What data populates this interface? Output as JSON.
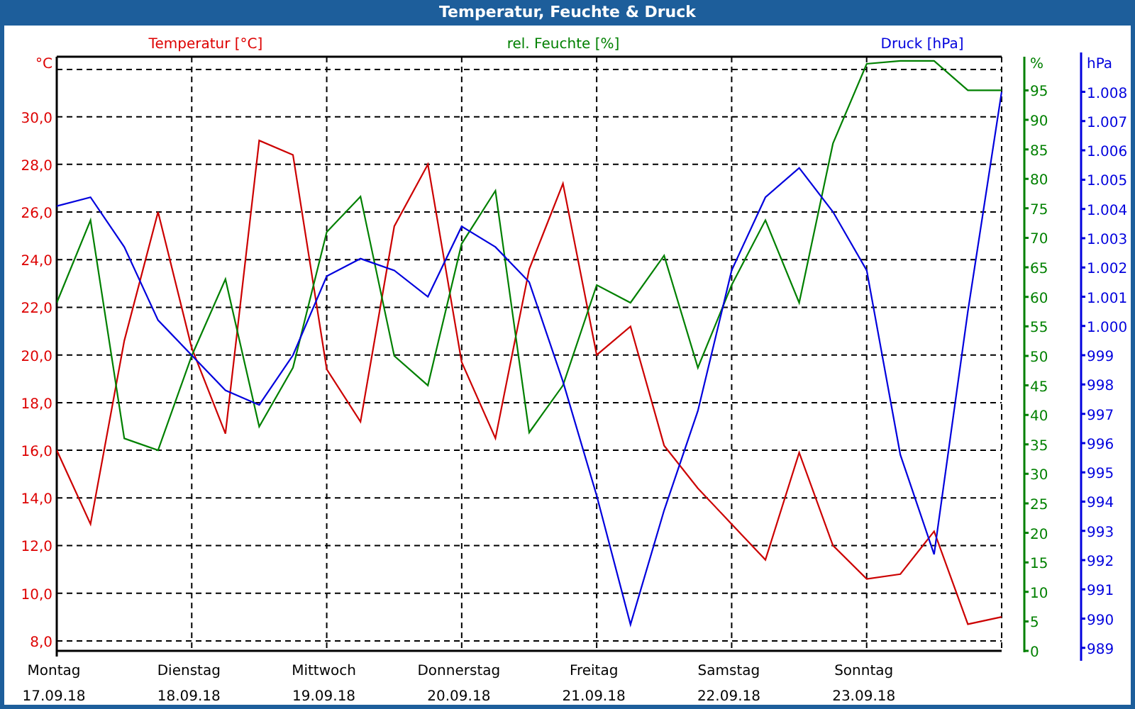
{
  "window": {
    "title": "Temperatur, Feuchte & Druck"
  },
  "chart": {
    "chart_data": {
      "type": "line",
      "grid": true,
      "categories": [
        "Montag 17.09.18",
        null,
        null,
        null,
        "Dienstag 18.09.18",
        null,
        null,
        null,
        "Mittwoch 19.09.18",
        null,
        null,
        null,
        "Donnerstag 20.09.18",
        null,
        null,
        null,
        "Freitag 21.09.18",
        null,
        null,
        null,
        "Samstag 22.09.18",
        null,
        null,
        null,
        "Sonntag 23.09.18",
        null,
        null,
        null,
        null
      ],
      "ylabel": "°C",
      "ylim": [
        7.58,
        32.52
      ],
      "yticks": [
        {
          "value": 8,
          "label": "8,0"
        },
        {
          "value": 10,
          "label": "10,0"
        },
        {
          "value": 12,
          "label": "12,0"
        },
        {
          "value": 14,
          "label": "14,0"
        },
        {
          "value": 16,
          "label": "16,0"
        },
        {
          "value": 18,
          "label": "18,0"
        },
        {
          "value": 20,
          "label": "20,0"
        },
        {
          "value": 22,
          "label": "22,0"
        },
        {
          "value": 24,
          "label": "24,0"
        },
        {
          "value": 26,
          "label": "26,0"
        },
        {
          "value": 28,
          "label": "28,0"
        },
        {
          "value": 30,
          "label": "30,0"
        }
      ],
      "y2label": "%",
      "y2lim": [
        0,
        100.7
      ],
      "y2ticks": [
        0,
        5,
        10,
        15,
        20,
        25,
        30,
        35,
        40,
        45,
        50,
        55,
        60,
        65,
        70,
        75,
        80,
        85,
        90,
        95
      ],
      "y3label": "hPa",
      "y3lim": [
        988.9,
        1009.2
      ],
      "y3ticks": [
        989,
        990,
        991,
        992,
        993,
        994,
        995,
        996,
        997,
        998,
        999,
        {
          "value": 1000,
          "label": "1.000"
        },
        {
          "value": 1001,
          "label": "1.001"
        },
        {
          "value": 1002,
          "label": "1.002"
        },
        {
          "value": 1003,
          "label": "1.003"
        },
        {
          "value": 1004,
          "label": "1.004"
        },
        {
          "value": 1005,
          "label": "1.005"
        },
        {
          "value": 1006,
          "label": "1.006"
        },
        {
          "value": 1007,
          "label": "1.007"
        },
        {
          "value": 1008,
          "label": "1.008"
        }
      ],
      "series": [
        {
          "name": "Temperatur [°C]",
          "color": "#cc0000",
          "values": [
            16.0,
            12.9,
            20.6,
            26.0,
            20.3,
            16.7,
            29.0,
            28.4,
            19.4,
            17.2,
            25.4,
            28.0,
            19.7,
            16.5,
            23.6,
            27.2,
            20.0,
            21.2,
            16.2,
            14.4,
            12.9,
            11.4,
            15.9,
            12.0,
            10.6,
            10.8,
            12.6,
            8.7,
            9.0
          ]
        },
        {
          "name": "rel. Feuchte [%]",
          "color": "#008000",
          "axis": "y2",
          "values": [
            59,
            73,
            36,
            34,
            50,
            63,
            38,
            48,
            71,
            77,
            50,
            45,
            69,
            78,
            37,
            45,
            62,
            59,
            67,
            48,
            62,
            73,
            59,
            86,
            99.5,
            100,
            100,
            95,
            95
          ]
        },
        {
          "name": "Druck [hPa]",
          "color": "#0000dd",
          "axis": "y3",
          "values": [
            1004.1,
            1004.4,
            1002.7,
            1000.2,
            999.0,
            997.8,
            997.3,
            999.0,
            1001.7,
            1002.3,
            1001.9,
            1001.0,
            1003.4,
            1002.7,
            1001.5,
            998.1,
            994.2,
            989.8,
            993.7,
            997.1,
            1001.9,
            1004.4,
            1005.4,
            1003.9,
            1001.9,
            995.6,
            992.2,
            1000.5,
            1008.0
          ]
        }
      ]
    }
  }
}
